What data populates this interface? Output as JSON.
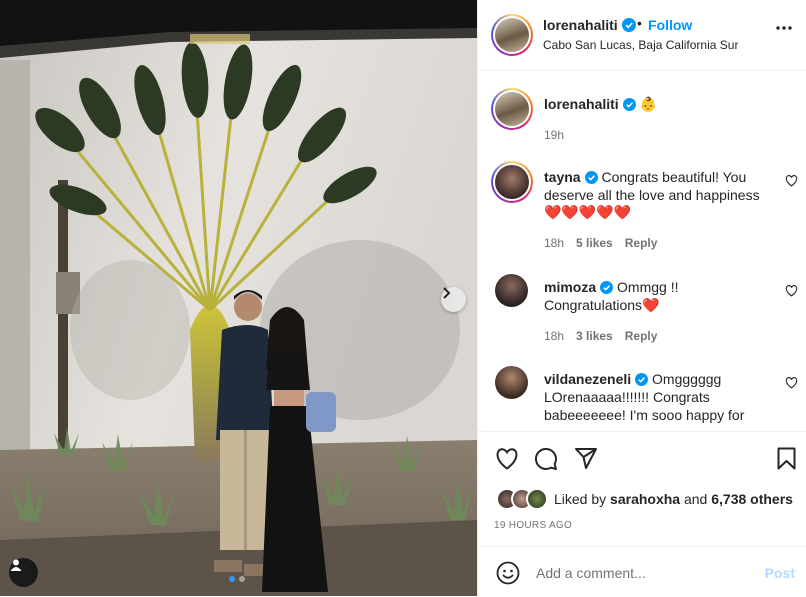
{
  "post": {
    "author": "lorenahaliti",
    "separator": "•",
    "follow_label": "Follow",
    "location": "Cabo San Lucas, Baja California Sur"
  },
  "caption": {
    "username": "lorenahaliti",
    "emoji": "👶",
    "time": "19h"
  },
  "comments": [
    {
      "username": "tayna",
      "text": "Congrats beautiful! You deserve all the love and happiness",
      "emoji": "❤️❤️❤️❤️❤️",
      "time": "18h",
      "likes": "5 likes",
      "reply": "Reply"
    },
    {
      "username": "mimoza",
      "text": "Ommgg !! Congratulations",
      "emoji": "❤️",
      "time": "18h",
      "likes": "3 likes",
      "reply": "Reply"
    },
    {
      "username": "vildanezeneli",
      "text": "Omgggggg LOrenaaaaa!!!!!!! Congrats babeeeeeee! I'm sooo happy for",
      "emoji": "",
      "time": "",
      "likes": "",
      "reply": ""
    }
  ],
  "likes": {
    "prefix": "Liked by",
    "user": "sarahoxha",
    "conj": "and",
    "others": "6,738 others"
  },
  "timestamp": "19 HOURS AGO",
  "composer": {
    "placeholder": "Add a comment...",
    "post_label": "Post"
  },
  "colors": {
    "accent": "#0095f6",
    "heart": "#ed4956",
    "post_disabled": "#b3dbff",
    "muted": "#737373"
  },
  "carousel": {
    "slide_count": 2,
    "active_slide": 1
  }
}
